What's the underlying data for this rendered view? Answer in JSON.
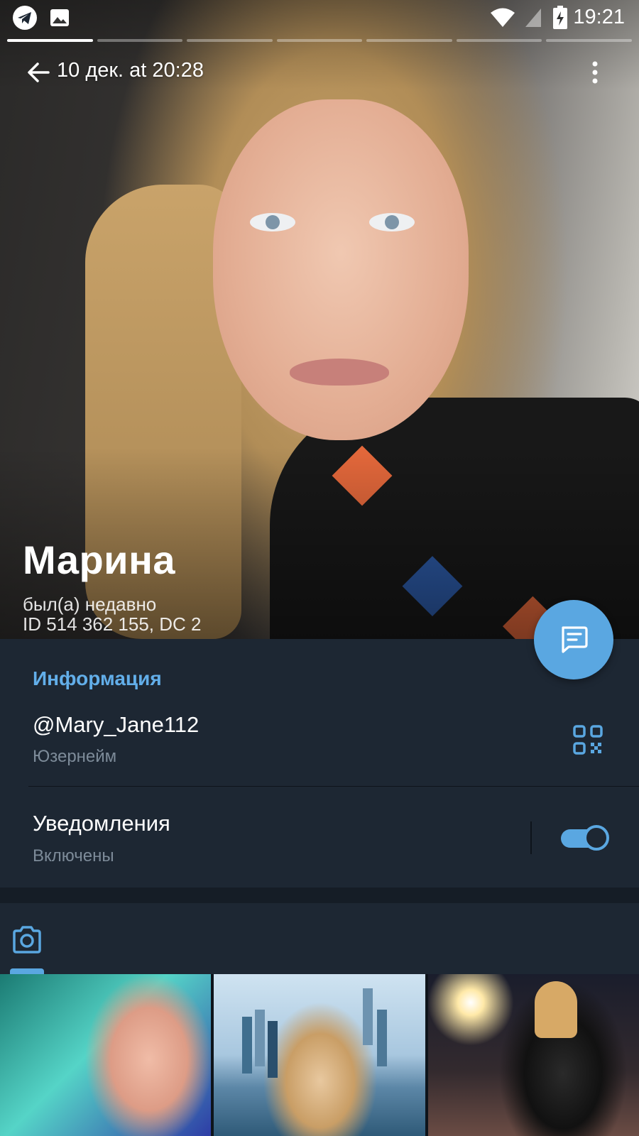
{
  "status_bar": {
    "time": "19:21",
    "icons": [
      "telegram-icon",
      "gallery-icon",
      "wifi-icon",
      "signal-icon",
      "battery-charging-icon"
    ]
  },
  "story": {
    "segments": 7,
    "active_segment": 1
  },
  "app_bar": {
    "date": "10 дек. at 20:28",
    "back_icon": "arrow-left-icon",
    "menu_icon": "more-vertical-icon"
  },
  "profile": {
    "name": "Марина",
    "status": "был(а) недавно",
    "id_line": "ID 514 362 155, DC 2"
  },
  "fab": {
    "icon": "message-icon"
  },
  "info": {
    "section_title": "Информация",
    "username": "@Mary_Jane112",
    "username_caption": "Юзернейм",
    "qr_icon": "qr-code-icon",
    "notifications_label": "Уведомления",
    "notifications_caption": "Включены",
    "notifications_enabled": true
  },
  "media": {
    "tab_icon": "camera-icon",
    "thumbnails": [
      "photo-1",
      "photo-2",
      "photo-3"
    ]
  },
  "colors": {
    "accent": "#5aa7e1",
    "background": "#1d2733",
    "section_title": "#62aee9",
    "caption": "#7d8b99"
  }
}
